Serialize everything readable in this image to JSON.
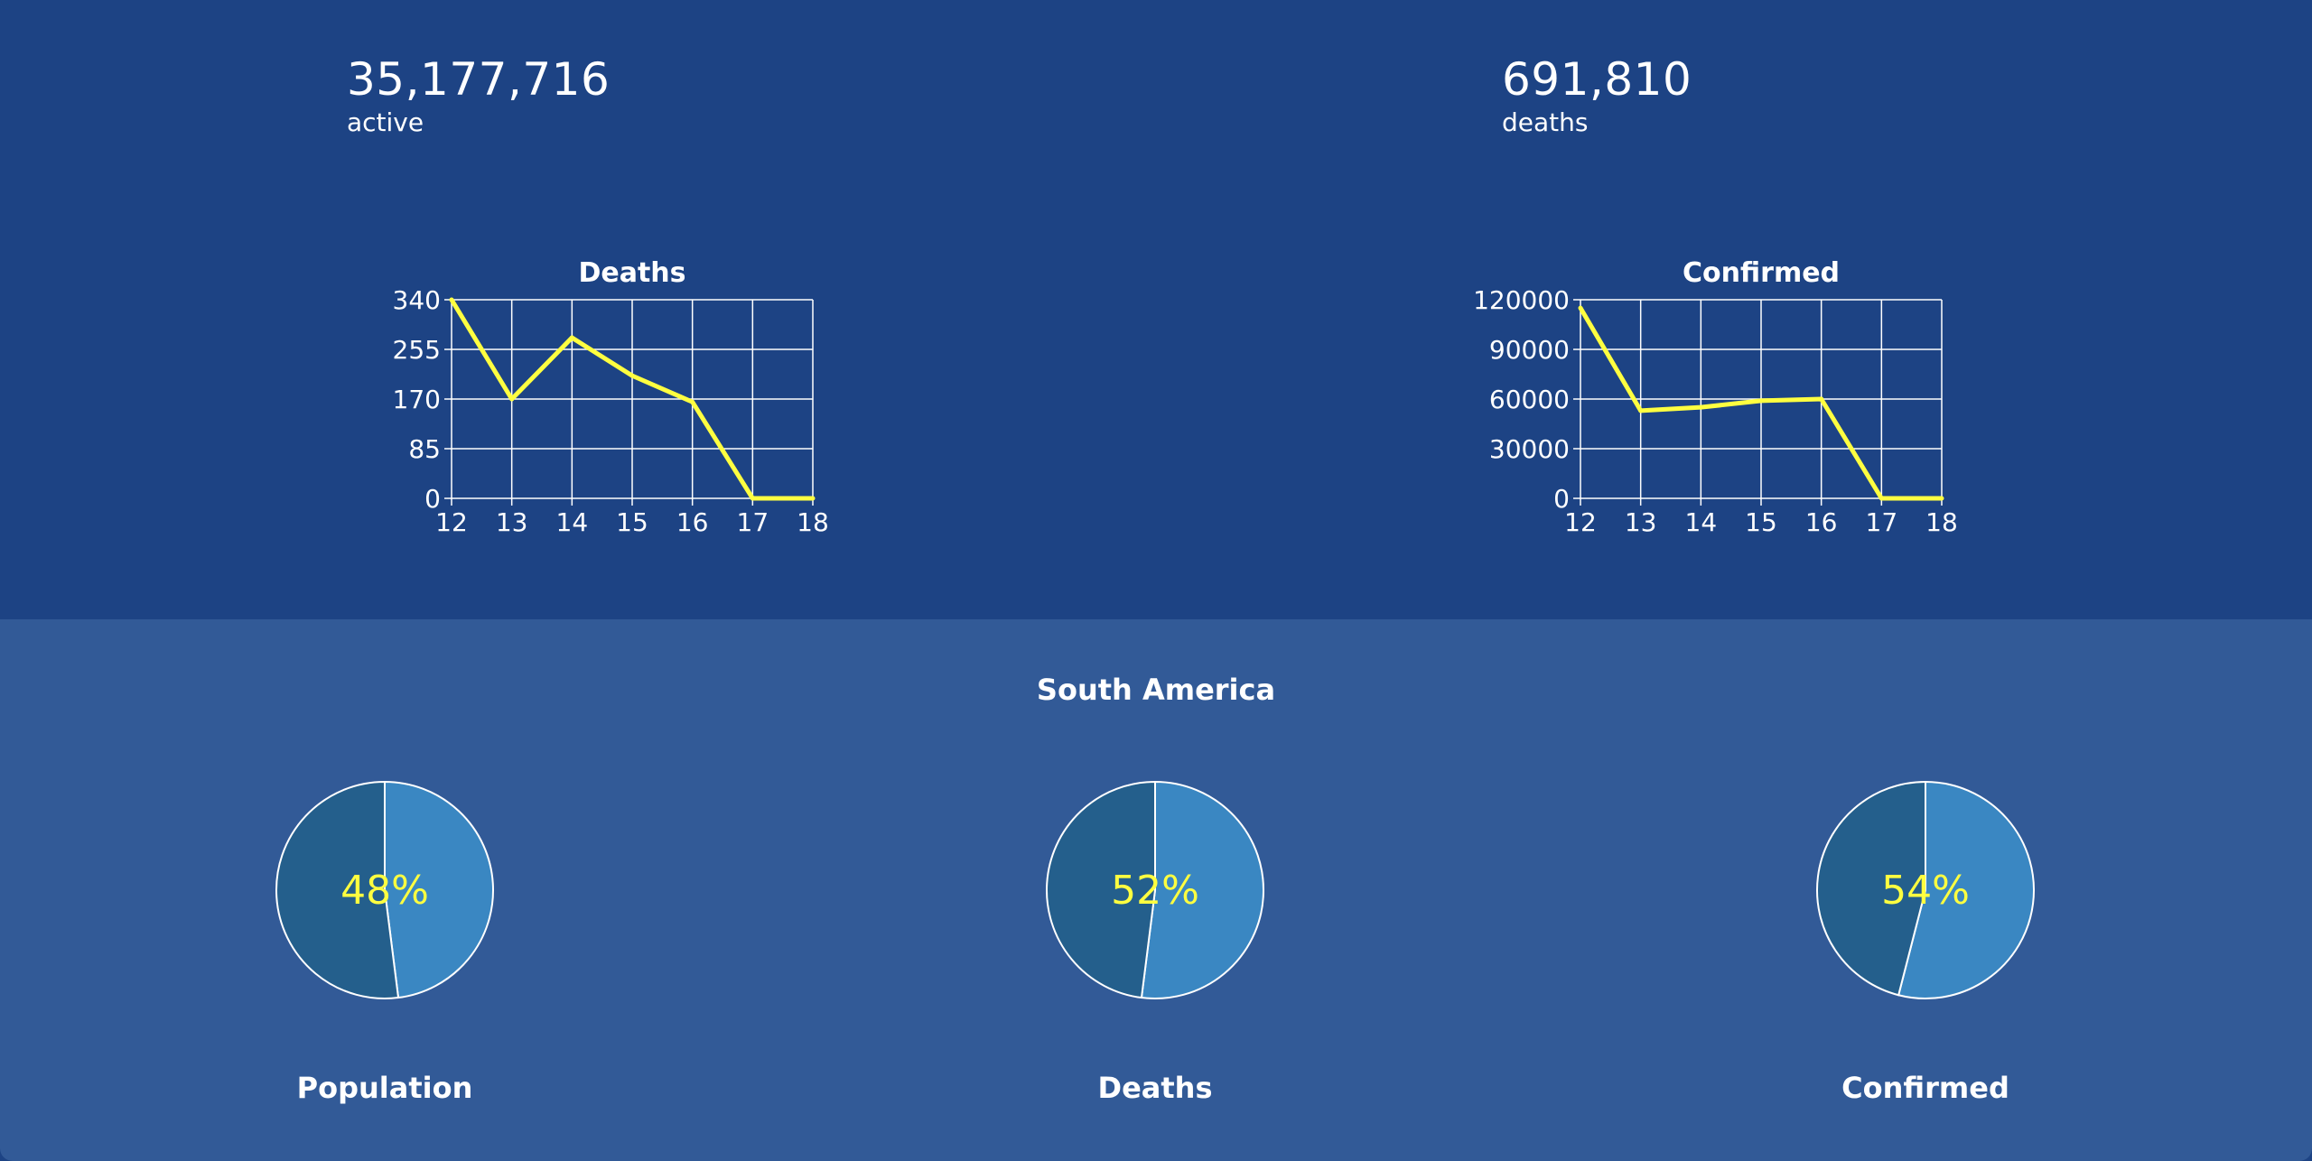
{
  "stats": {
    "active": {
      "value": "35,177,716",
      "label": "active"
    },
    "deaths": {
      "value": "691,810",
      "label": "deaths"
    }
  },
  "region": {
    "title": "South America"
  },
  "colors": {
    "line": "#ffff40",
    "grid": "#ffffff",
    "pie_light": "#3a87c2",
    "pie_dark": "#245f8c",
    "pct_text": "#ffff40"
  },
  "chart_data": [
    {
      "type": "line",
      "title": "Deaths",
      "x": [
        12,
        13,
        14,
        15,
        16,
        17,
        18
      ],
      "y": [
        340,
        170,
        275,
        210,
        165,
        0,
        0
      ],
      "yticks": [
        0,
        85,
        170,
        255,
        340
      ],
      "ylim": [
        0,
        340
      ],
      "grid": true
    },
    {
      "type": "line",
      "title": "Confirmed",
      "x": [
        12,
        13,
        14,
        15,
        16,
        17,
        18
      ],
      "y": [
        115000,
        53000,
        55000,
        59000,
        60000,
        0,
        0
      ],
      "yticks": [
        0,
        30000,
        60000,
        90000,
        120000
      ],
      "ylim": [
        0,
        120000
      ],
      "grid": true
    },
    {
      "type": "pie",
      "title": "Population",
      "percent_label": "48%",
      "values": [
        48,
        52
      ]
    },
    {
      "type": "pie",
      "title": "Deaths",
      "percent_label": "52%",
      "values": [
        52,
        48
      ]
    },
    {
      "type": "pie",
      "title": "Confirmed",
      "percent_label": "54%",
      "values": [
        54,
        46
      ]
    }
  ]
}
